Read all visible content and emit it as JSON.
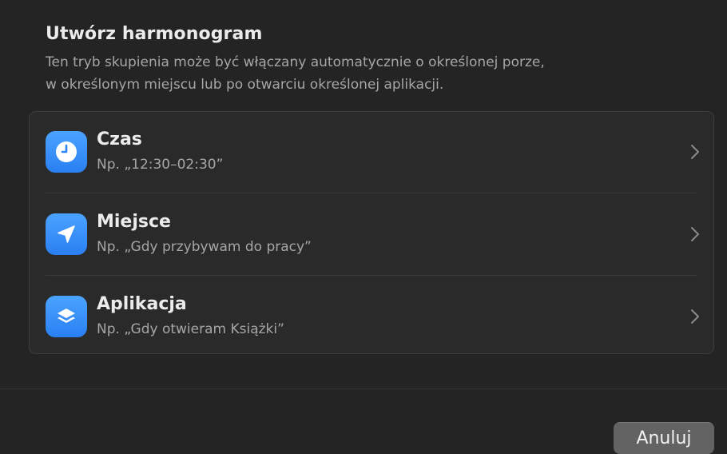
{
  "header": {
    "title": "Utwórz harmonogram",
    "description_line1": "Ten tryb skupienia może być włączany automatycznie o określonej porze,",
    "description_line2": "w określonym miejscu lub po otwarciu określonej aplikacji."
  },
  "options": [
    {
      "title": "Czas",
      "subtitle": "Np. „12:30–02:30”",
      "icon": "clock-icon"
    },
    {
      "title": "Miejsce",
      "subtitle": "Np. „Gdy przybywam do pracy”",
      "icon": "location-arrow-icon"
    },
    {
      "title": "Aplikacja",
      "subtitle": "Np. „Gdy otwieram Książki”",
      "icon": "app-layers-icon"
    }
  ],
  "footer": {
    "cancel_label": "Anuluj"
  },
  "colors": {
    "accent": "#2f87f5",
    "background": "#242424",
    "card": "#2a2a2a",
    "button": "#636363"
  }
}
